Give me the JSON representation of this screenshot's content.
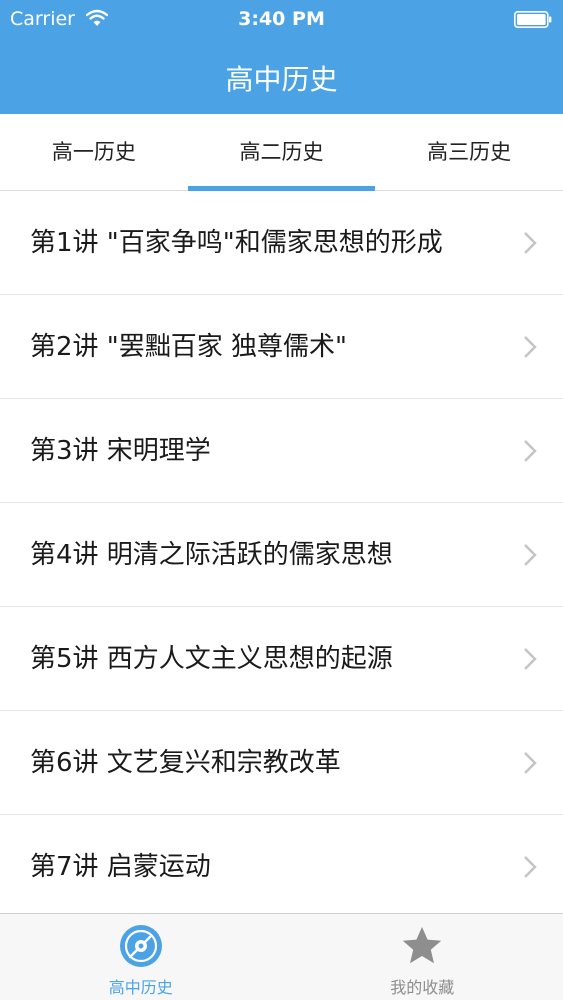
{
  "status_bar": {
    "carrier": "Carrier",
    "time": "3:40 PM"
  },
  "nav": {
    "title": "高中历史"
  },
  "tabs": [
    {
      "label": "高一历史",
      "active": false
    },
    {
      "label": "高二历史",
      "active": true
    },
    {
      "label": "高三历史",
      "active": false
    }
  ],
  "lessons": [
    {
      "label": "第1讲 \"百家争鸣\"和儒家思想的形成"
    },
    {
      "label": "第2讲 \"罢黜百家 独尊儒术\""
    },
    {
      "label": "第3讲 宋明理学"
    },
    {
      "label": "第4讲 明清之际活跃的儒家思想"
    },
    {
      "label": "第5讲 西方人文主义思想的起源"
    },
    {
      "label": "第6讲 文艺复兴和宗教改革"
    },
    {
      "label": "第7讲 启蒙运动"
    }
  ],
  "tabbar": [
    {
      "label": "高中历史",
      "icon": "disc-icon",
      "active": true
    },
    {
      "label": "我的收藏",
      "icon": "star-icon",
      "active": false
    }
  ],
  "colors": {
    "accent": "#4ba3e6",
    "inactive": "#8e8e8e"
  }
}
